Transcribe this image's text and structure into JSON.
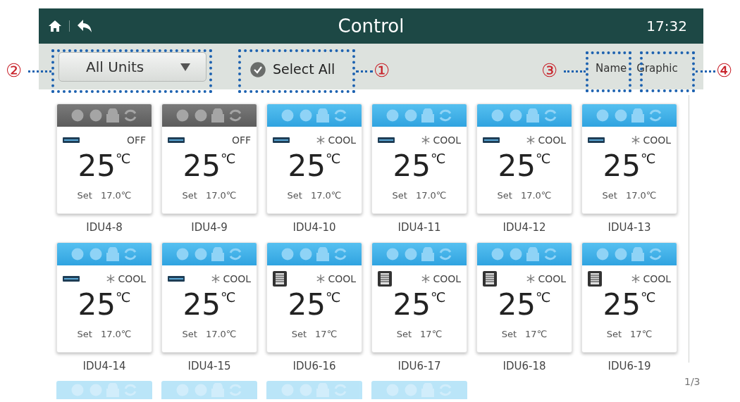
{
  "header": {
    "title": "Control",
    "time": "17:32"
  },
  "toolbar": {
    "dropdown": {
      "value": "All Units"
    },
    "select_all": {
      "label": "Select All",
      "checked": true
    },
    "view_links": [
      {
        "label": "Name"
      },
      {
        "label": "Graphic"
      }
    ]
  },
  "units": [
    {
      "name": "IDU4-8",
      "kind": "wall",
      "on": false,
      "mode": "OFF",
      "temp": "25",
      "unit": "℃",
      "set_label": "Set",
      "set_value": "17.0℃"
    },
    {
      "name": "IDU4-9",
      "kind": "wall",
      "on": false,
      "mode": "OFF",
      "temp": "25",
      "unit": "℃",
      "set_label": "Set",
      "set_value": "17.0℃"
    },
    {
      "name": "IDU4-10",
      "kind": "wall",
      "on": true,
      "mode": "COOL",
      "temp": "25",
      "unit": "℃",
      "set_label": "Set",
      "set_value": "17.0℃"
    },
    {
      "name": "IDU4-11",
      "kind": "wall",
      "on": true,
      "mode": "COOL",
      "temp": "25",
      "unit": "℃",
      "set_label": "Set",
      "set_value": "17.0℃"
    },
    {
      "name": "IDU4-12",
      "kind": "wall",
      "on": true,
      "mode": "COOL",
      "temp": "25",
      "unit": "℃",
      "set_label": "Set",
      "set_value": "17.0℃"
    },
    {
      "name": "IDU4-13",
      "kind": "wall",
      "on": true,
      "mode": "COOL",
      "temp": "25",
      "unit": "℃",
      "set_label": "Set",
      "set_value": "17.0℃"
    },
    {
      "name": "IDU4-14",
      "kind": "wall",
      "on": true,
      "mode": "COOL",
      "temp": "25",
      "unit": "℃",
      "set_label": "Set",
      "set_value": "17.0℃"
    },
    {
      "name": "IDU4-15",
      "kind": "wall",
      "on": true,
      "mode": "COOL",
      "temp": "25",
      "unit": "℃",
      "set_label": "Set",
      "set_value": "17.0℃"
    },
    {
      "name": "IDU6-16",
      "kind": "cassette",
      "on": true,
      "mode": "COOL",
      "temp": "25",
      "unit": "℃",
      "set_label": "Set",
      "set_value": "17℃"
    },
    {
      "name": "IDU6-17",
      "kind": "cassette",
      "on": true,
      "mode": "COOL",
      "temp": "25",
      "unit": "℃",
      "set_label": "Set",
      "set_value": "17℃"
    },
    {
      "name": "IDU6-18",
      "kind": "cassette",
      "on": true,
      "mode": "COOL",
      "temp": "25",
      "unit": "℃",
      "set_label": "Set",
      "set_value": "17℃"
    },
    {
      "name": "IDU6-19",
      "kind": "cassette",
      "on": true,
      "mode": "COOL",
      "temp": "25",
      "unit": "℃",
      "set_label": "Set",
      "set_value": "17℃"
    }
  ],
  "partial_units": [
    {
      "on": true
    },
    {
      "on": true
    },
    {
      "on": true
    },
    {
      "on": true
    }
  ],
  "page_indicator": "1/3",
  "callouts": [
    {
      "label": "②"
    },
    {
      "label": "①"
    },
    {
      "label": "③"
    },
    {
      "label": "④"
    }
  ]
}
